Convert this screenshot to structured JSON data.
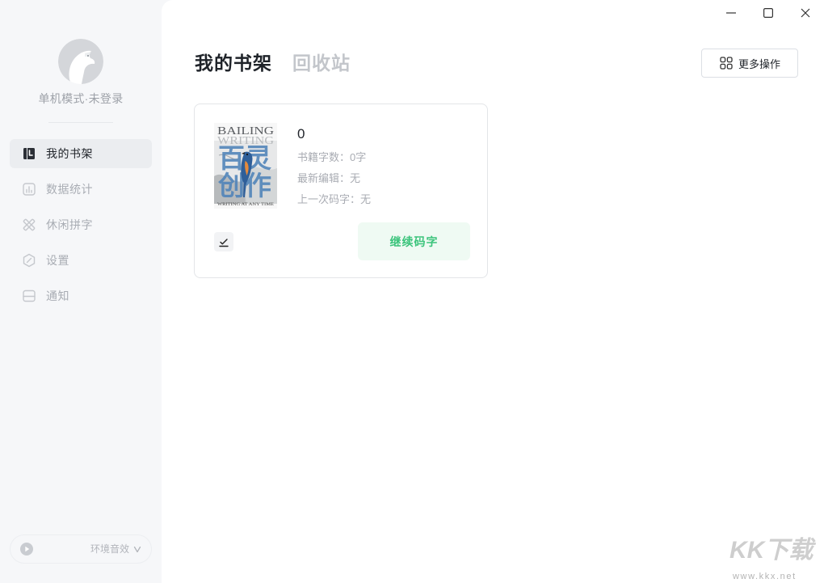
{
  "window": {
    "minimize_icon": "minimize-icon",
    "maximize_icon": "maximize-icon",
    "close_icon": "close-icon"
  },
  "sidebar": {
    "avatar_icon": "bird-avatar-icon",
    "user_status": "单机模式·未登录",
    "nav": [
      {
        "label": "我的书架",
        "icon": "bookshelf-icon",
        "active": true
      },
      {
        "label": "数据统计",
        "icon": "chart-icon",
        "active": false
      },
      {
        "label": "休闲拼字",
        "icon": "tools-icon",
        "active": false
      },
      {
        "label": "设置",
        "icon": "settings-icon",
        "active": false
      },
      {
        "label": "通知",
        "icon": "mail-icon",
        "active": false
      }
    ],
    "ambient_sound": {
      "icon": "play-icon",
      "label": "环境音效",
      "chevron_icon": "chevron-down-icon"
    }
  },
  "main": {
    "tabs": [
      {
        "label": "我的书架",
        "active": true
      },
      {
        "label": "回收站",
        "active": false
      }
    ],
    "more_actions": {
      "icon": "grid-icon",
      "label": "更多操作"
    },
    "books": [
      {
        "title": "0",
        "cover": {
          "line1": "BAILING",
          "line2": "WRITING",
          "chars_top": "百灵",
          "chars_bottom": "创作",
          "tagline": "WRITING AT ANY TIME"
        },
        "word_count": "书籍字数：0字",
        "last_edit": "最新编辑：无",
        "last_typing": "上一次码字：无",
        "edit_icon": "edit-icon",
        "continue_label": "继续码字"
      }
    ]
  },
  "watermark": {
    "logo": "KK下载",
    "url": "www.kkx.net"
  },
  "colors": {
    "sidebar_bg": "#f6f7f9",
    "main_bg": "#ffffff",
    "active_nav_bg": "#ebedf0",
    "text_primary": "#1f2329",
    "text_muted": "#a9adb4",
    "accent_green": "#3cc47c",
    "accent_green_bg": "#effaf3"
  }
}
